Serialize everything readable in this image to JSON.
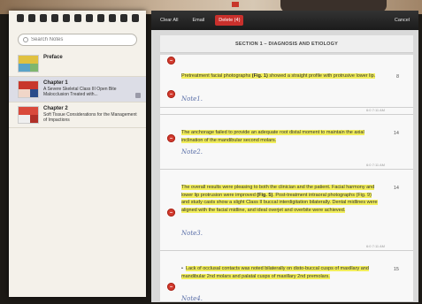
{
  "sidebar": {
    "search_placeholder": "Search Notes",
    "chapters": [
      {
        "title": "Preface",
        "subtitle": ""
      },
      {
        "title": "Chapter 1",
        "subtitle": "A Severe Skeletal Class III Open Bite Malocclusion Treated with..."
      },
      {
        "title": "Chapter 2",
        "subtitle": "Soft Tissue Considerations for the Management of Impactions"
      }
    ]
  },
  "toolbar": {
    "clear_all": "Clear All",
    "email": "Email",
    "delete": "Delete (4)",
    "cancel": "Cancel"
  },
  "section": {
    "title": "SECTION 1 – DIAGNOSIS AND ETIOLOGY"
  },
  "notes": [
    {
      "text_pre": "Pretreatment facial photographs ",
      "fig": "(Fig. 1)",
      "text_post": " showed a straight profile with protrusive lower lip.",
      "page": "8",
      "handnote": "Note1.",
      "stamp": "6:0 7:11 AM"
    },
    {
      "text_pre": "The anchorage failed to provide an adequate root distal moment to maintain the axial inclination of the mandibular second molars.",
      "fig": "",
      "text_post": "",
      "page": "14",
      "handnote": "Note2.",
      "stamp": "6:0 7:11 AM"
    },
    {
      "text_pre": "The overall results were pleasing to both the clinician and the patient. Facial harmony and lower lip protrusion were improved ",
      "fig": "(Fig. 5)",
      "text_post": ". Post-treatment intraoral photographs (Fig. 9) and study casts show a slight Class II buccal interdigitation bilaterally. Dental midlines were aligned with the facial midline, and ideal overjet and overbite were achieved.",
      "page": "14",
      "handnote": "Note3.",
      "stamp": "6:0 7:11 AM"
    },
    {
      "text_pre": "Lack of occlusal contacts was noted bilaterally on disto-buccal cusps of maxillary and mandibular 2nd molars and palatal cusps of maxillary 2nd premolars.",
      "fig": "",
      "text_post": "",
      "page": "15",
      "handnote": "Note4.",
      "stamp": ""
    }
  ],
  "colors": {
    "highlight": "#f2ee5a",
    "delete_red": "#c9302c",
    "handwriting": "#5a6fa8"
  }
}
